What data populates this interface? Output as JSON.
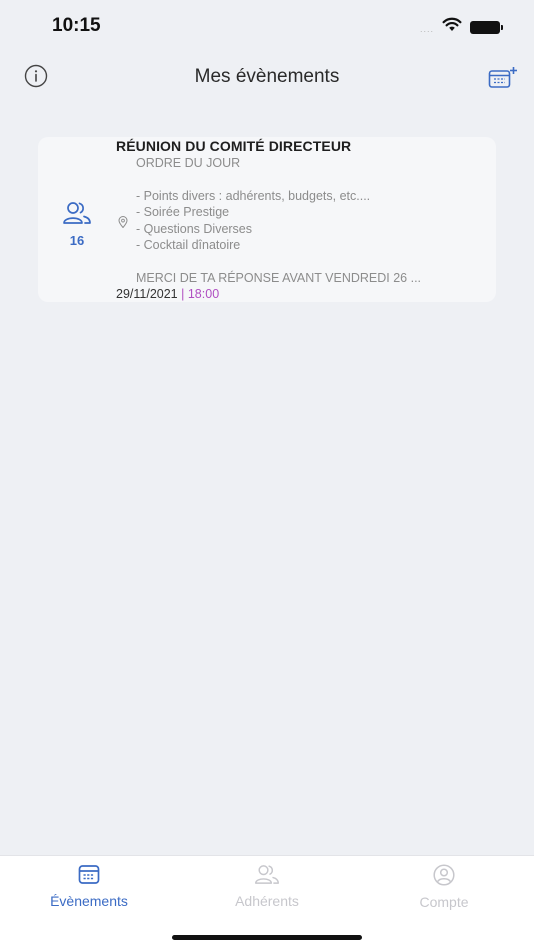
{
  "status_bar": {
    "time": "10:15",
    "signal": "....",
    "icons": [
      "wifi-icon",
      "battery-icon"
    ]
  },
  "nav": {
    "title": "Mes évènements",
    "left_icon": "info-icon",
    "right_icon": "calendar-plus-icon"
  },
  "event": {
    "title": "RÉUNION DU COMITÉ DIRECTEUR",
    "attendee_count": "16",
    "attendee_icon": "people-icon",
    "location_icon": "location-pin-icon",
    "description_lines": [
      "ORDRE DU JOUR",
      "",
      "- Points divers : adhérents, budgets, etc....",
      "- Soirée Prestige",
      "- Questions Diverses",
      "- Cocktail dînatoire",
      "",
      "MERCI DE TA RÉPONSE AVANT VENDREDI 26 ..."
    ],
    "date": "29/11/2021",
    "separator": "|",
    "time": "18:00"
  },
  "tabs": [
    {
      "label": "Évènements",
      "icon": "calendar-icon",
      "active": true
    },
    {
      "label": "Adhérents",
      "icon": "people-icon",
      "active": false
    },
    {
      "label": "Compte",
      "icon": "account-icon",
      "active": false
    }
  ],
  "colors": {
    "accent": "#3b6bc4",
    "time_accent": "#b04fc2",
    "background": "#eef0f4",
    "card": "#f6f7f9",
    "inactive": "#c7c7cc"
  }
}
